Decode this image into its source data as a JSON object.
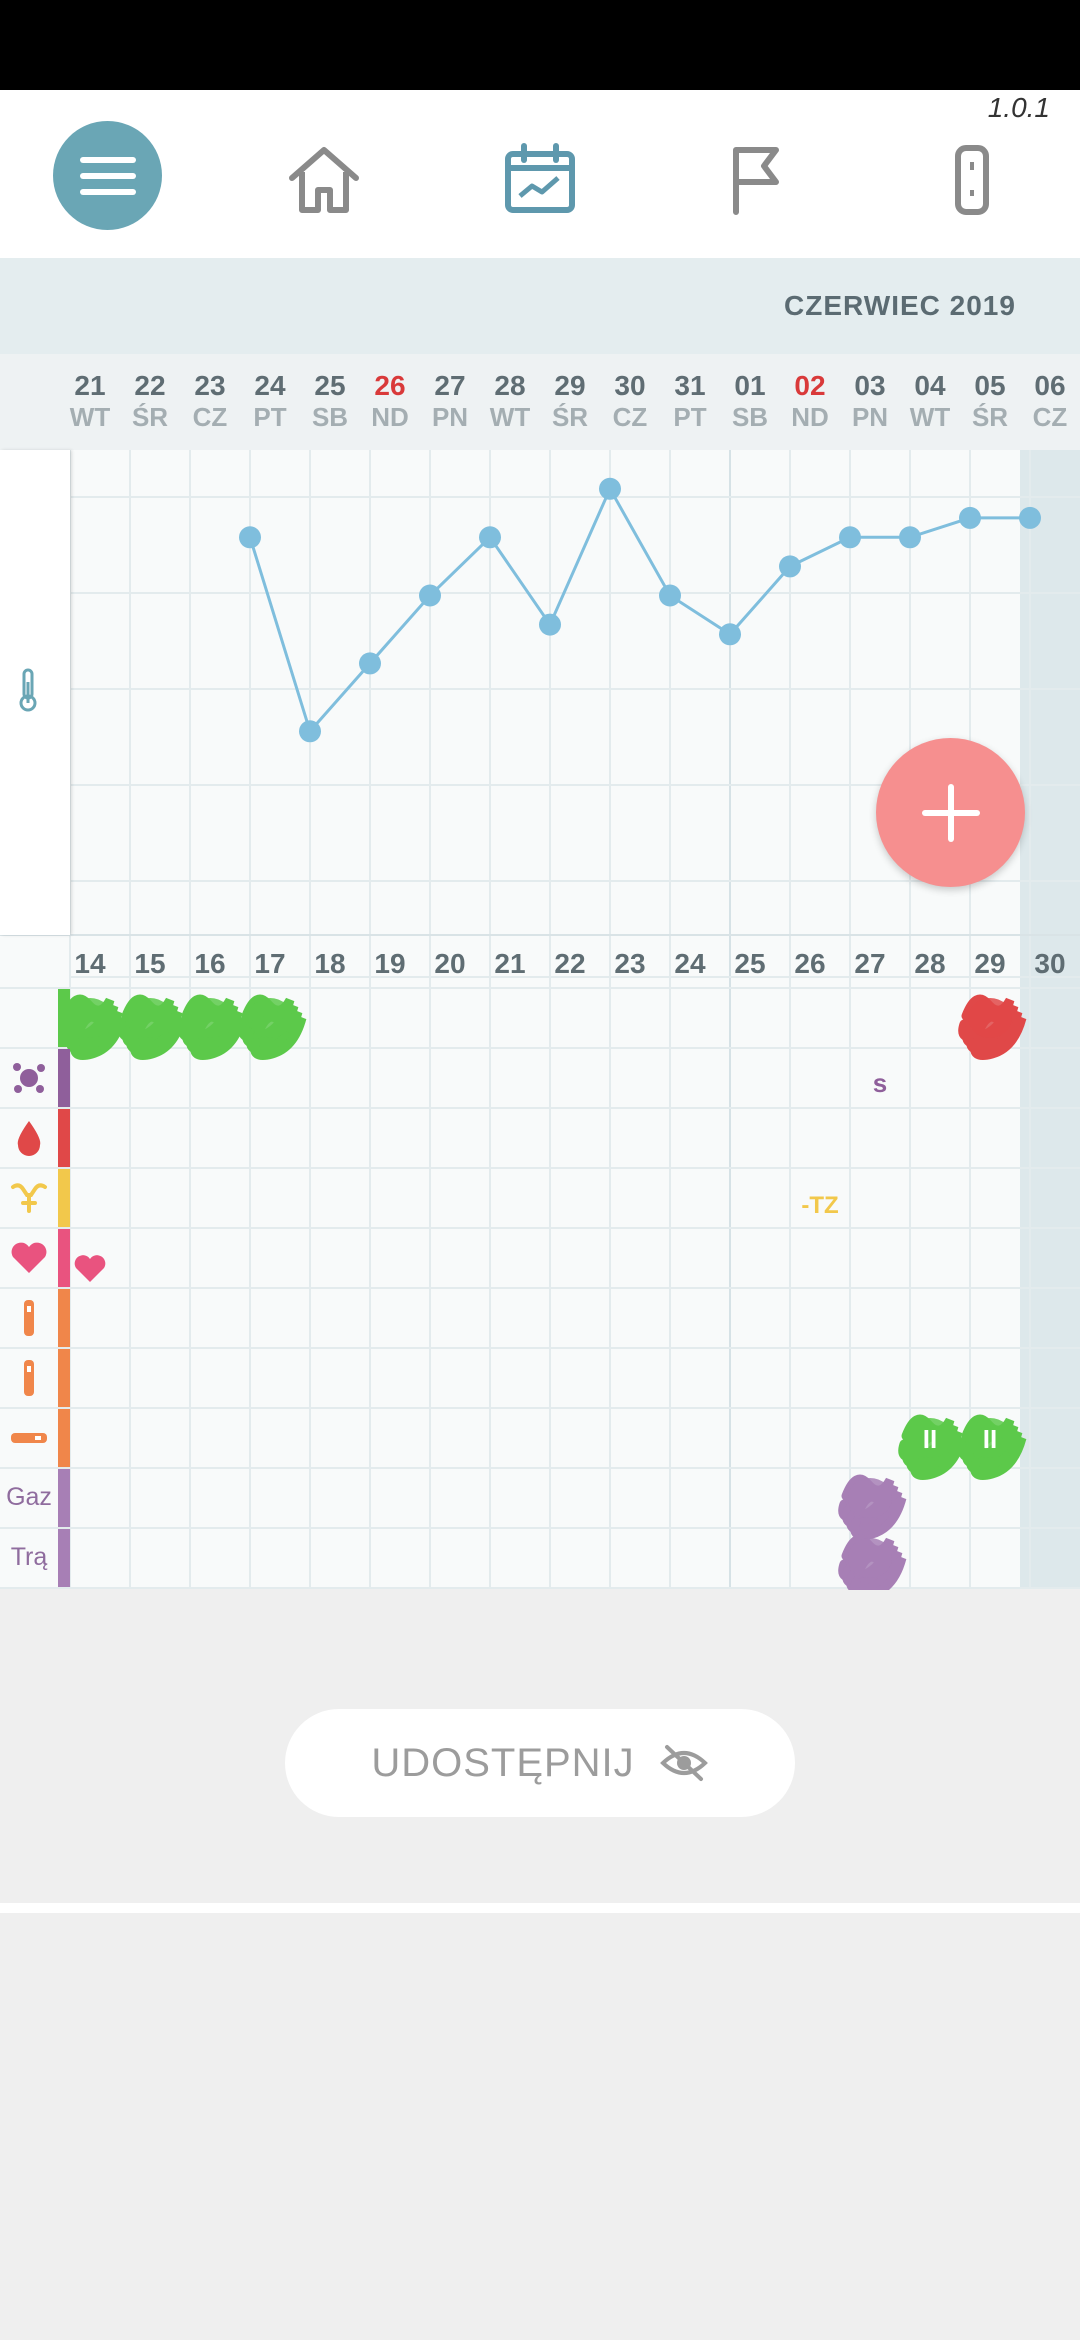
{
  "app": {
    "version": "1.0.1"
  },
  "nav": {
    "items": [
      {
        "name": "menu",
        "icon": "hamburger-menu-icon"
      },
      {
        "name": "home",
        "icon": "home-icon"
      },
      {
        "name": "calendar-chart",
        "icon": "calendar-chart-icon"
      },
      {
        "name": "flag",
        "icon": "flag-icon"
      },
      {
        "name": "thermometer-device",
        "icon": "device-icon"
      }
    ]
  },
  "calendar": {
    "month_label": "CZERWIEC 2019",
    "days": [
      {
        "num": "21",
        "wd": "WT"
      },
      {
        "num": "22",
        "wd": "ŚR"
      },
      {
        "num": "23",
        "wd": "CZ"
      },
      {
        "num": "24",
        "wd": "PT"
      },
      {
        "num": "25",
        "wd": "SB"
      },
      {
        "num": "26",
        "wd": "ND"
      },
      {
        "num": "27",
        "wd": "PN"
      },
      {
        "num": "28",
        "wd": "WT"
      },
      {
        "num": "29",
        "wd": "ŚR"
      },
      {
        "num": "30",
        "wd": "CZ"
      },
      {
        "num": "31",
        "wd": "PT"
      },
      {
        "num": "01",
        "wd": "SB"
      },
      {
        "num": "02",
        "wd": "ND"
      },
      {
        "num": "03",
        "wd": "PN"
      },
      {
        "num": "04",
        "wd": "WT"
      },
      {
        "num": "05",
        "wd": "ŚR"
      },
      {
        "num": "06",
        "wd": "CZ"
      }
    ],
    "cycle_days": [
      "14",
      "15",
      "16",
      "17",
      "18",
      "19",
      "20",
      "21",
      "22",
      "23",
      "24",
      "25",
      "26",
      "27",
      "28",
      "29",
      "30"
    ],
    "rows": [
      {
        "label": "",
        "color": "#5cc94a"
      },
      {
        "icon": "splat-icon",
        "color": "#8f5f9b"
      },
      {
        "icon": "drop-icon",
        "color": "#e04848"
      },
      {
        "icon": "uterus-icon",
        "color": "#f2c84b"
      },
      {
        "icon": "heart-icon",
        "color": "#e9537f"
      },
      {
        "icon": "test-strip-icon",
        "color": "#f0864a"
      },
      {
        "icon": "test-strip-icon",
        "color": "#f0864a"
      },
      {
        "icon": "test-horizontal-icon",
        "color": "#f0864a"
      },
      {
        "label": "Gaz",
        "color": "#a77fb5"
      },
      {
        "label": "Trą",
        "color": "#a77fb5"
      }
    ],
    "annotations": {
      "splat_letter": "s",
      "uterus_text": "-TZ"
    }
  },
  "chart_data": {
    "type": "line",
    "x": [
      "24",
      "25",
      "26",
      "27",
      "28",
      "29",
      "30",
      "31",
      "01",
      "02",
      "03",
      "04",
      "05",
      "06"
    ],
    "values": [
      4.55,
      3.55,
      3.9,
      4.25,
      4.55,
      4.1,
      4.8,
      4.25,
      4.05,
      4.4,
      4.55,
      4.55,
      4.65,
      4.65
    ],
    "grid": true
  },
  "share": {
    "label": "UDOSTĘPNIJ",
    "icon": "eye-off-icon"
  },
  "colors": {
    "accent": "#6aa6b5",
    "fab": "#f68f8f",
    "line": "#7fbedd",
    "weekend_red": "#d93a3a"
  }
}
